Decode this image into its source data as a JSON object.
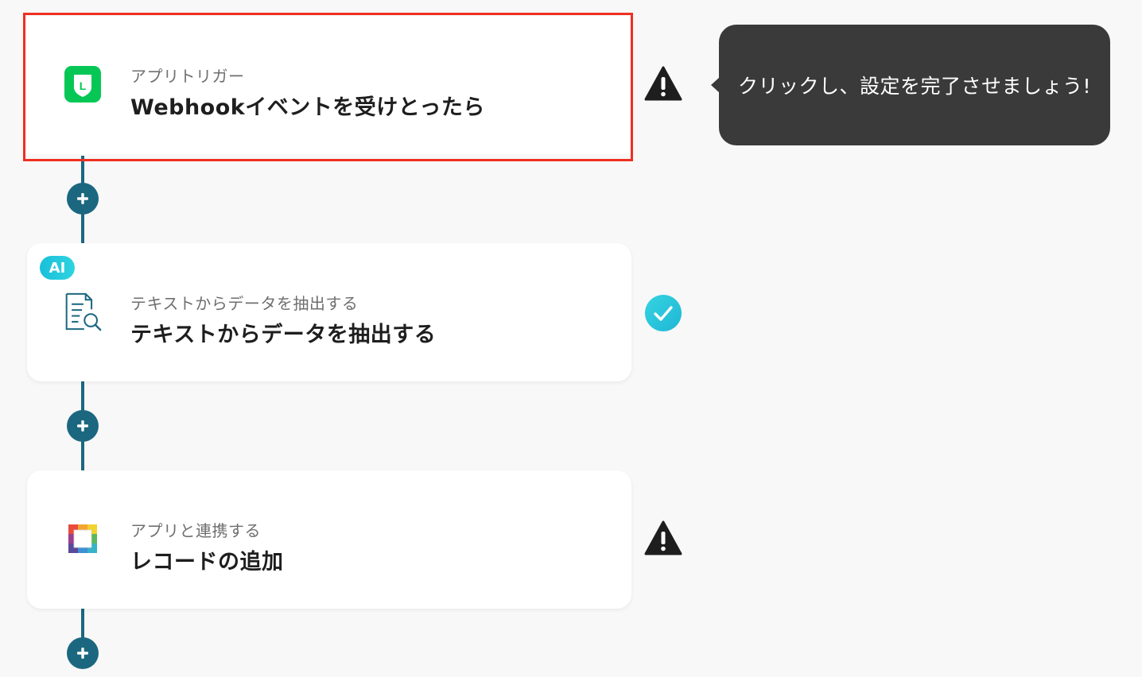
{
  "flow": {
    "steps": [
      {
        "subtitle": "アプリトリガー",
        "title": "Webhookイベントを受けとったら",
        "icon": "line-app-icon",
        "status": "warning",
        "selected": true
      },
      {
        "badge": "AI",
        "subtitle": "テキストからデータを抽出する",
        "title": "テキストからデータを抽出する",
        "icon": "document-search-icon",
        "status": "complete"
      },
      {
        "subtitle": "アプリと連携する",
        "title": "レコードの追加",
        "icon": "database-app-icon",
        "status": "warning"
      }
    ],
    "add_button_icon": "plus-icon"
  },
  "tooltip": {
    "text": "クリックし、設定を完了させましょう!"
  },
  "colors": {
    "connector": "#1c6780",
    "highlight": "#ef2f22",
    "line_brand": "#06c755",
    "complete": "#27c4dd",
    "warning": "#1e1e1e",
    "tooltip_bg": "#3a3a3a"
  }
}
